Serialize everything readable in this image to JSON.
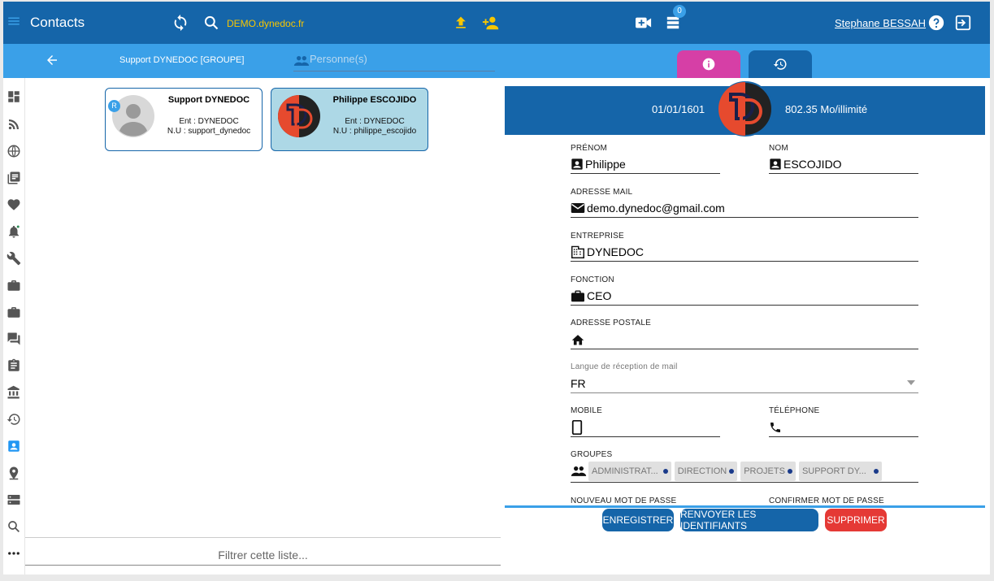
{
  "header": {
    "app_title": "Contacts",
    "domain": "DEMO.dynedoc.fr",
    "badge_count": "0",
    "user_name": "Stephane BESSAH"
  },
  "subbar": {
    "group_title": "Support DYNEDOC [GROUPE]",
    "person_placeholder": "Personne(s)"
  },
  "contacts": [
    {
      "name": "Support  DYNEDOC",
      "ent": "Ent : DYNEDOC",
      "nu": "N.U : support_dynedoc",
      "badge": "R"
    },
    {
      "name": "Philippe  ESCOJIDO",
      "ent": "Ent : DYNEDOC",
      "nu": "N.U : philippe_escojido"
    }
  ],
  "filter_placeholder": "Filtrer cette liste...",
  "detail": {
    "created_date": "01/01/1601",
    "quota": "802.35 Mo/illimité",
    "labels": {
      "firstname": "PRÉNOM",
      "lastname": "NOM",
      "email": "ADRESSE MAIL",
      "company": "ENTREPRISE",
      "function": "FONCTION",
      "address": "ADRESSE POSTALE",
      "language": "Langue de réception de mail",
      "mobile": "MOBILE",
      "phone": "TÉLÉPHONE",
      "groups": "GROUPES",
      "new_password": "NOUVEAU MOT DE PASSE",
      "confirm_password": "CONFIRMER MOT DE PASSE"
    },
    "values": {
      "firstname": "Philippe",
      "lastname": "ESCOJIDO",
      "email": "demo.dynedoc@gmail.com",
      "company": "DYNEDOC",
      "function": "CEO",
      "address": "",
      "language": "FR",
      "mobile": "",
      "phone": ""
    },
    "groups": [
      "ADMINISTRAT...",
      "DIRECTION",
      "PROJETS",
      "SUPPORT DY..."
    ]
  },
  "buttons": {
    "save": "ENREGISTRER",
    "resend": "RENVOYER LES IDENTIFIANTS",
    "delete": "SUPPRIMER"
  },
  "colors": {
    "primary": "#1565a9",
    "secondary": "#3aa0e8",
    "accent_yellow": "#f7c600",
    "tab_info": "#d63fa6",
    "delete": "#e53935",
    "selected_card": "#add8e6"
  }
}
